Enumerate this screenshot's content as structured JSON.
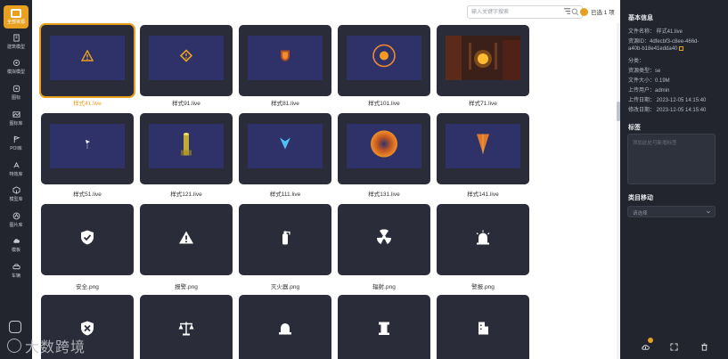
{
  "sidebar": {
    "logo_label": "全部资源",
    "items": [
      {
        "label": "建筑模型",
        "icon": "building-icon"
      },
      {
        "label": "模拟模型",
        "icon": "model-icon"
      },
      {
        "label": "图标",
        "icon": "icon-library-icon"
      },
      {
        "label": "图标库",
        "icon": "gallery-icon"
      },
      {
        "label": "POI库",
        "icon": "flag-icon"
      },
      {
        "label": "特效库",
        "icon": "effect-icon"
      },
      {
        "label": "模型库",
        "icon": "cube-icon"
      },
      {
        "label": "图片库",
        "icon": "image-icon"
      },
      {
        "label": "模板",
        "icon": "cloud-icon"
      },
      {
        "label": "车辆",
        "icon": "car-icon"
      }
    ]
  },
  "topbar": {
    "search_placeholder": "输入关键字搜索",
    "selected_text": "已选 1 项"
  },
  "grid": {
    "cards": [
      {
        "label": "样式41.live",
        "kind": "warning-triangle",
        "selected": true
      },
      {
        "label": "样式91.live",
        "kind": "warning-diamond"
      },
      {
        "label": "样式81.live",
        "kind": "shield-glow"
      },
      {
        "label": "样式101.live",
        "kind": "orange-ring"
      },
      {
        "label": "样式71.live",
        "kind": "photo"
      },
      {
        "label": "样式51.live",
        "kind": "small-pin"
      },
      {
        "label": "样式121.live",
        "kind": "yellow-cylinder"
      },
      {
        "label": "样式111.live",
        "kind": "blue-arrow"
      },
      {
        "label": "样式131.live",
        "kind": "orange-sphere"
      },
      {
        "label": "样式141.live",
        "kind": "orange-cone"
      },
      {
        "label": "安全.png",
        "kind": "shield-check"
      },
      {
        "label": "报警.png",
        "kind": "alert-triangle"
      },
      {
        "label": "灭火器.png",
        "kind": "extinguisher"
      },
      {
        "label": "辐射.png",
        "kind": "radiation"
      },
      {
        "label": "警报.png",
        "kind": "siren"
      },
      {
        "label": "",
        "kind": "shield-x"
      },
      {
        "label": "",
        "kind": "scale"
      },
      {
        "label": "",
        "kind": "siren-small"
      },
      {
        "label": "",
        "kind": "pillar"
      },
      {
        "label": "",
        "kind": "building"
      }
    ]
  },
  "panel": {
    "basic_info_title": "基本信息",
    "file_name": "文件名称： 样式41.live",
    "resource_id_1": "资源ID：4dfecbf3-c8ee-466d-",
    "resource_id_2": "a40b-b18e41edda40",
    "category": "分类：",
    "resource_type": "资源类型：se",
    "file_size": "文件大小：0.19M",
    "uploader": "上传用户：admin",
    "upload_date": "上传日期： 2023-12-05 14:15:40",
    "modify_date": "修改日期： 2023-12-05 14:15:40",
    "tags_title": "标签",
    "tags_placeholder": "添加此处可新增标签",
    "category_move_title": "类目移动",
    "category_select_value": "请选择"
  },
  "watermark": "大数跨境",
  "colors": {
    "accent": "#e8a020",
    "sidebar_bg": "#22252e",
    "card_bg": "#2a2d39",
    "screen_bg": "#2f3268"
  }
}
